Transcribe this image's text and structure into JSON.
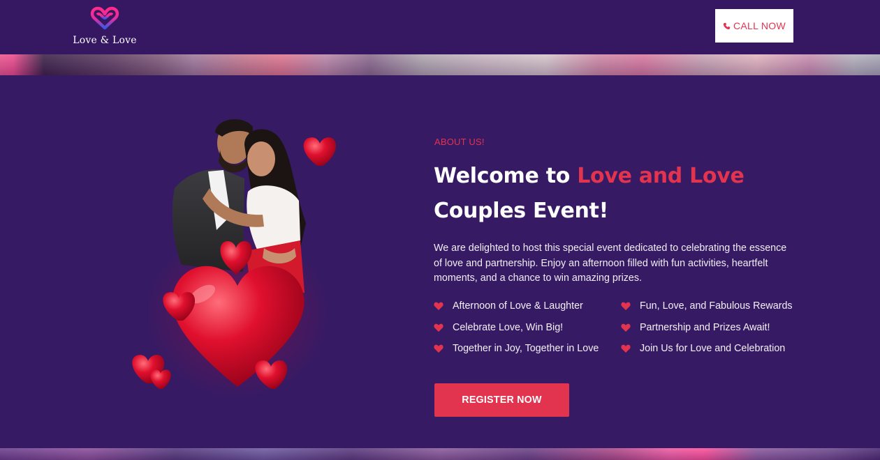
{
  "brand": {
    "logo_text": "Love & Love",
    "logo_icon": "infinity-heart-icon",
    "colors": {
      "pink": "#ff2b8a",
      "blue": "#3a57e8"
    }
  },
  "header": {
    "call_label": "CALL NOW",
    "call_icon": "phone-icon"
  },
  "about": {
    "eyebrow": "ABOUT US!",
    "headline_part1": "Welcome to ",
    "headline_accent": "Love and Love",
    "headline_part2": "Couples Event!",
    "description": "We are delighted to host this special event dedicated to celebrating the essence of love and partnership. Enjoy an afternoon filled with fun activities, heartfelt moments, and a chance to win amazing prizes.",
    "features": [
      {
        "label": "Afternoon of Love & Laughter",
        "icon": "heart-icon"
      },
      {
        "label": "Fun, Love, and Fabulous Rewards",
        "icon": "heart-icon"
      },
      {
        "label": "Celebrate Love, Win Big!",
        "icon": "heart-icon"
      },
      {
        "label": "Partnership and Prizes Await!",
        "icon": "heart-icon"
      },
      {
        "label": "Together in Joy, Together in Love",
        "icon": "heart-icon"
      },
      {
        "label": "Join Us for Love and Celebration",
        "icon": "heart-icon"
      }
    ],
    "register_label": "REGISTER NOW"
  },
  "theme": {
    "background": "#371a64",
    "accent": "#e2334f",
    "text": "#ffffff"
  }
}
